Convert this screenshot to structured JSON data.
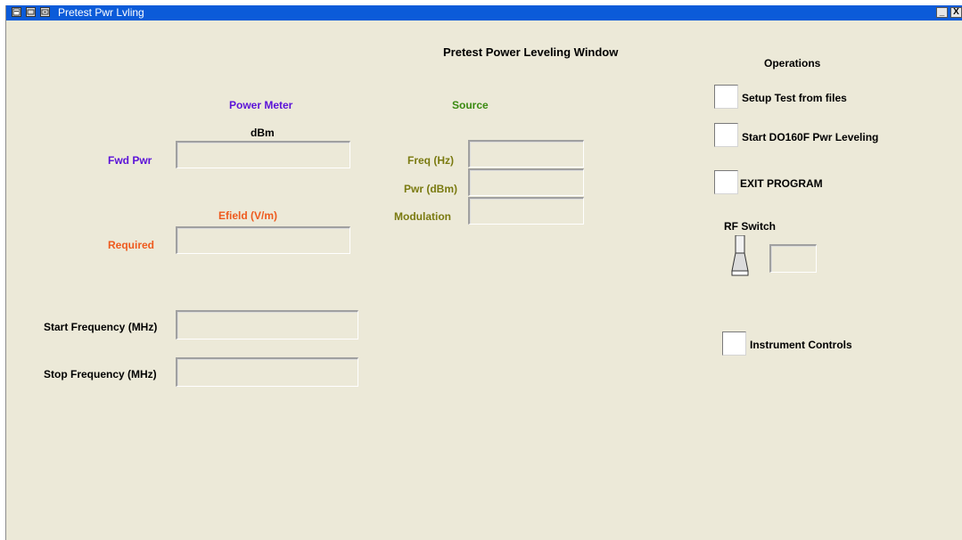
{
  "window": {
    "title": "Pretest Pwr Lvling",
    "heading": "Pretest Power Leveling Window",
    "minimize_label": "_",
    "close_label": "X"
  },
  "power_meter": {
    "header": "Power Meter",
    "unit_label": "dBm",
    "fwd_pwr_label": "Fwd Pwr",
    "fwd_pwr_value": "",
    "efield_label": "Efield (V/m)",
    "required_label": "Required",
    "required_value": ""
  },
  "source": {
    "header": "Source",
    "freq_label": "Freq (Hz)",
    "freq_value": "",
    "pwr_label": "Pwr (dBm)",
    "pwr_value": "",
    "modulation_label": "Modulation",
    "modulation_value": ""
  },
  "frequency": {
    "start_label": "Start Frequency (MHz)",
    "start_value": "",
    "stop_label": "Stop Frequency (MHz)",
    "stop_value": ""
  },
  "operations": {
    "header": "Operations",
    "setup_label": "Setup Test from files",
    "start_label": "Start DO160F Pwr Leveling",
    "exit_label": "EXIT PROGRAM",
    "rf_switch_label": "RF Switch",
    "rf_switch_value": "",
    "instrument_label": "Instrument Controls"
  },
  "colors": {
    "power_meter": "#5b12d8",
    "source": "#3a8a10",
    "efield": "#ee5a1e",
    "source_labels": "#7a7a10",
    "titlebar": "#0b5bd9",
    "panel": "#ece9d8"
  }
}
